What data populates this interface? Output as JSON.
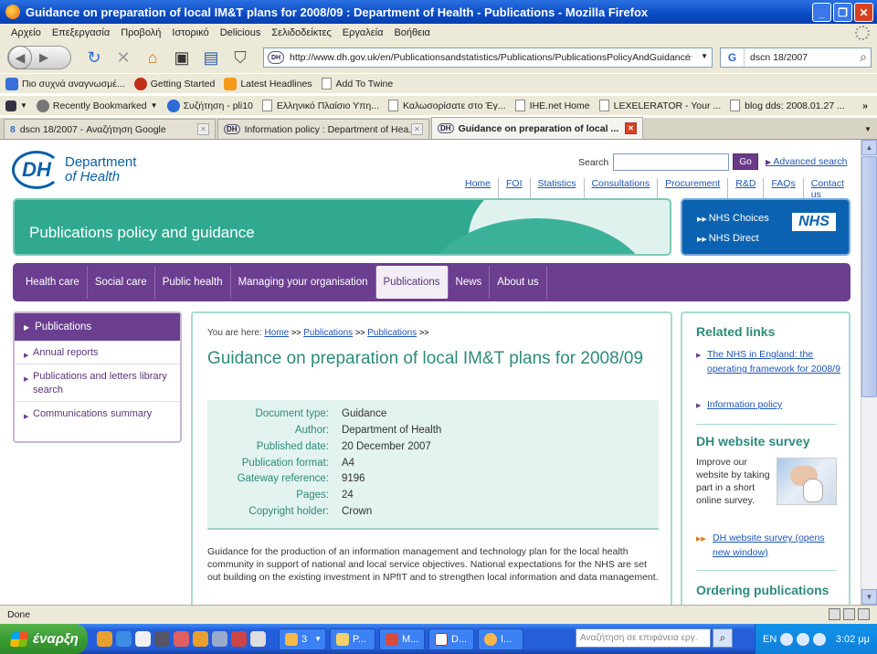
{
  "window": {
    "title": "Guidance on preparation of local IM&T plans for 2008/09 : Department of Health - Publications - Mozilla Firefox",
    "buttons": [
      "_",
      "❐",
      "✕"
    ]
  },
  "menu": [
    "Αρχείο",
    "Επεξεργασία",
    "Προβολή",
    "Ιστορικό",
    "Delicious",
    "Σελιδοδείκτες",
    "Εργαλεία",
    "Βοήθεια"
  ],
  "nav": {
    "url": "http://www.dh.gov.uk/en/Publicationsandstatistics/Publications/PublicationsPolicyAndGuidance",
    "search_value": "dscn 18/2007",
    "favicon_text": "DH"
  },
  "bookmarks1": [
    {
      "label": "Πιο συχνά αναγνωσμέ..."
    },
    {
      "label": "Getting Started"
    },
    {
      "label": "Latest Headlines"
    },
    {
      "label": "Add To Twine"
    }
  ],
  "bookmarks2": [
    {
      "label": "Recently Bookmarked"
    },
    {
      "label": "Συζήτηση - pli10"
    },
    {
      "label": "Ελληνικό Πλαίσιο Υπη..."
    },
    {
      "label": "Καλωσορίσατε στο Έγ..."
    },
    {
      "label": "IHE.net Home"
    },
    {
      "label": "LEXELERATOR - Your ..."
    },
    {
      "label": "blog dds: 2008.01.27 ..."
    }
  ],
  "tabs": [
    {
      "label": "dscn 18/2007 - Αναζήτηση Google",
      "fav": "8"
    },
    {
      "label": "Information policy : Department of Hea...",
      "fav": "DH"
    },
    {
      "label": "Guidance on preparation of local ...",
      "fav": "DH"
    }
  ],
  "page": {
    "logo_initials": "DH",
    "logo_line1": "Department",
    "logo_line2": "of Health",
    "search_label": "Search",
    "go_label": "Go",
    "advanced_search": "Advanced search",
    "top_links": [
      "Home",
      "FOI",
      "Statistics",
      "Consultations",
      "Procurement",
      "R&D",
      "FAQs",
      "Contact us"
    ],
    "banner_title": "Publications policy and guidance",
    "nhs_links": [
      "NHS Choices",
      "NHS Direct"
    ],
    "nhs_logo": "NHS",
    "main_nav": [
      "Health care",
      "Social care",
      "Public health",
      "Managing your organisation",
      "Publications",
      "News",
      "About us"
    ],
    "left_nav_head": "Publications",
    "left_nav": [
      "Annual reports",
      "Publications and letters library search",
      "Communications summary"
    ],
    "breadcrumb_label": "You are here:",
    "breadcrumb": [
      "Home",
      "Publications",
      "Publications"
    ],
    "breadcrumb_sep": ">>",
    "doc_title": "Guidance on preparation of local IM&T plans for 2008/09",
    "doc_info": [
      {
        "k": "Document type:",
        "v": "Guidance"
      },
      {
        "k": "Author:",
        "v": "Department of Health"
      },
      {
        "k": "Published date:",
        "v": "20 December 2007"
      },
      {
        "k": "Publication format:",
        "v": "A4"
      },
      {
        "k": "Gateway reference:",
        "v": "9196"
      },
      {
        "k": "Pages:",
        "v": "24"
      },
      {
        "k": "Copyright holder:",
        "v": "Crown"
      }
    ],
    "summary": "Guidance for the production of an information management and technology plan for the local health community in support of national and local service objectives. National expectations for the NHS are set out building on the existing investment in NPfIT and to strengthen local information and data management.",
    "related_title": "Related links",
    "related_links": [
      "The NHS in England: the operating framework for 2008/9",
      "Information policy"
    ],
    "survey_title": "DH website survey",
    "survey_text": "Improve our website by taking part in a short online survey.",
    "survey_link": "DH website survey (opens new window)",
    "ordering_title": "Ordering publications"
  },
  "status": "Done",
  "taskbar": {
    "start": "έναρξη",
    "tasks": [
      "3",
      "P...",
      "M...",
      "D...",
      "I..."
    ],
    "search_placeholder": "Αναζήτηση σε επιφάνεια εργ.",
    "lang": "EN",
    "clock": "3:02 μμ"
  }
}
